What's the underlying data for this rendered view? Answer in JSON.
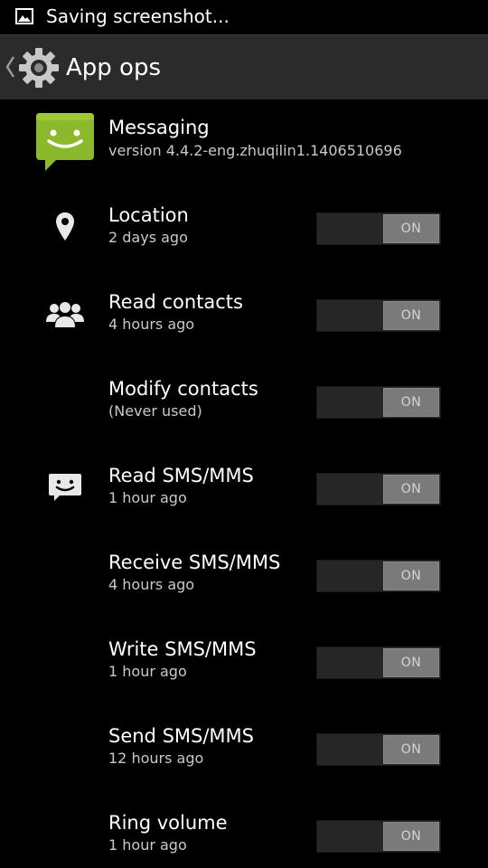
{
  "status_bar": {
    "text": "Saving screenshot...",
    "icon": "image-icon"
  },
  "action_bar": {
    "title": "App ops",
    "icon": "settings-gear-icon",
    "up_icon": "chevron-left-icon"
  },
  "app": {
    "name": "Messaging",
    "version": "version 4.4.2-eng.zhuqilin1.1406510696",
    "icon": "messaging-app-icon",
    "icon_color": "#8cb92b"
  },
  "ops": [
    {
      "title": "Location",
      "subtitle": "2 days ago",
      "icon": "location-pin-icon",
      "state": "ON"
    },
    {
      "title": "Read contacts",
      "subtitle": "4 hours ago",
      "icon": "contacts-icon",
      "state": "ON"
    },
    {
      "title": "Modify contacts",
      "subtitle": "(Never used)",
      "icon": "",
      "state": "ON"
    },
    {
      "title": "Read SMS/MMS",
      "subtitle": "1 hour ago",
      "icon": "sms-icon",
      "state": "ON"
    },
    {
      "title": "Receive SMS/MMS",
      "subtitle": "4 hours ago",
      "icon": "",
      "state": "ON"
    },
    {
      "title": "Write SMS/MMS",
      "subtitle": "1 hour ago",
      "icon": "",
      "state": "ON"
    },
    {
      "title": "Send SMS/MMS",
      "subtitle": "12 hours ago",
      "icon": "",
      "state": "ON"
    },
    {
      "title": "Ring volume",
      "subtitle": "1 hour ago",
      "icon": "",
      "state": "ON"
    }
  ]
}
